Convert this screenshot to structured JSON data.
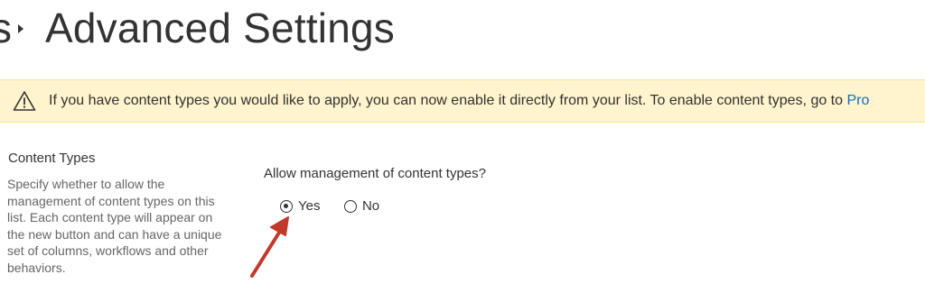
{
  "breadcrumb": {
    "previous_fragment": "s",
    "title": "Advanced Settings"
  },
  "banner": {
    "icon": "warning-icon",
    "text": "If you have content types you would like to apply, you can now enable it directly from your list. To enable content types, go to ",
    "link_text": "Pro",
    "background": "#fff4ce",
    "link_color": "#0e6fbf"
  },
  "content_types": {
    "title": "Content Types",
    "description": "Specify whether to allow the management of content types on this list. Each content type will appear on the new button and can have a unique set of columns, workflows and other behaviors.",
    "question": "Allow management of content types?",
    "options": [
      {
        "label": "Yes",
        "selected": true
      },
      {
        "label": "No",
        "selected": false
      }
    ]
  },
  "annotation": {
    "icon": "red-arrow-icon",
    "color": "#c0392b"
  }
}
